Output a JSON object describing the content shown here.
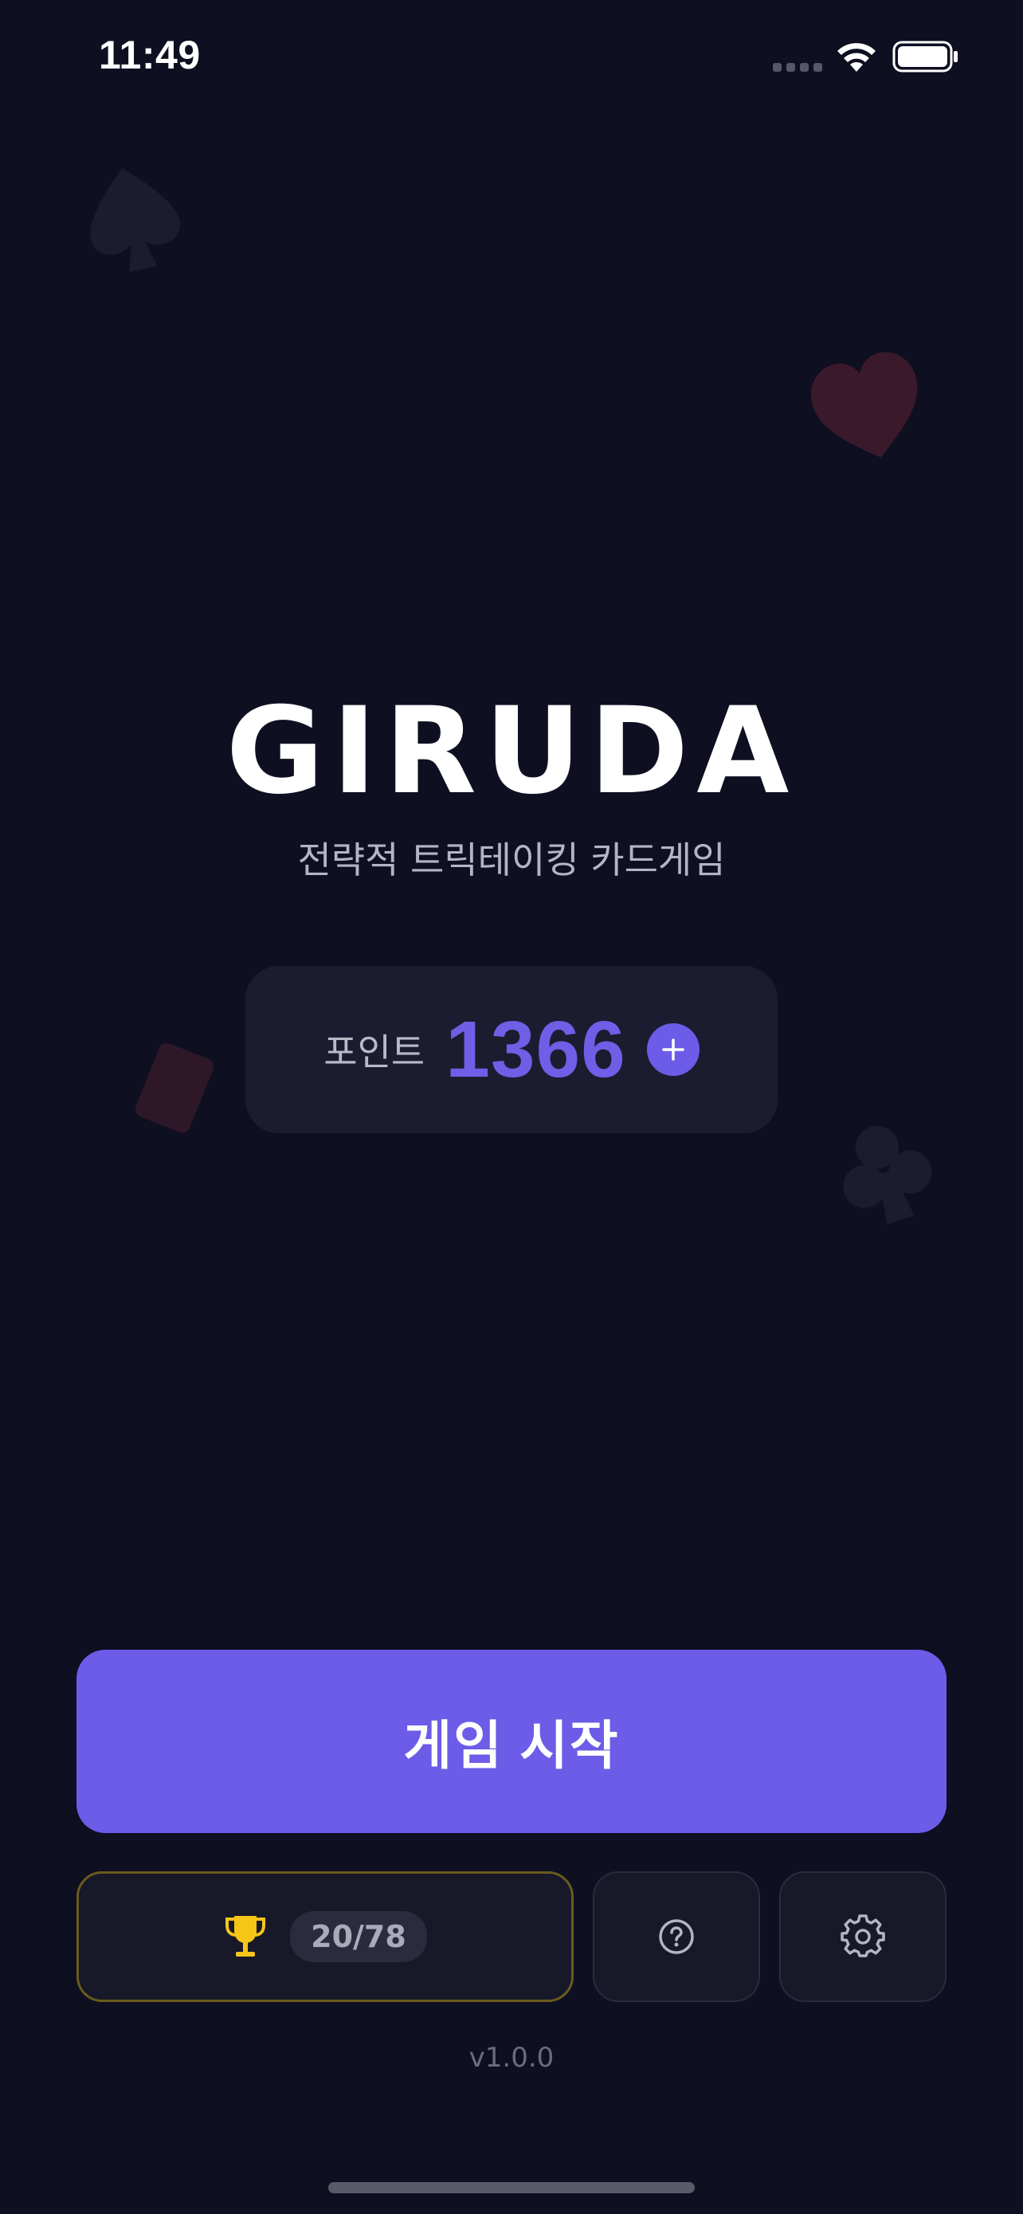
{
  "status_bar": {
    "time": "11:49"
  },
  "app": {
    "title": "GIRUDA",
    "subtitle": "전략적 트릭테이킹 카드게임",
    "version": "v1.0.0"
  },
  "points": {
    "label": "포인트",
    "value": "1366"
  },
  "buttons": {
    "start": "게임 시작",
    "achievements_count": "20/78"
  },
  "icons": {
    "add": "plus-icon",
    "achievements": "trophy-icon",
    "help": "question-circle-icon",
    "settings": "gear-icon"
  },
  "colors": {
    "background": "#0e0f21",
    "accent": "#6c5ce7",
    "card": "#1b1c2f",
    "trophy": "#f5c518"
  }
}
